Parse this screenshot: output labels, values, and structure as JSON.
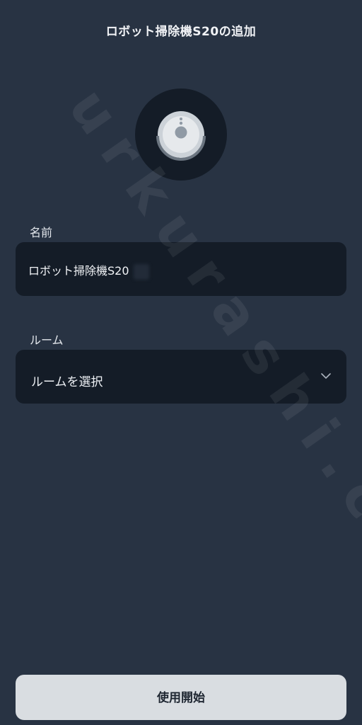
{
  "header": {
    "title": "ロボット掃除機S20の追加"
  },
  "device": {
    "icon": "robot-vacuum-icon"
  },
  "name_field": {
    "label": "名前",
    "value": "ロボット掃除機S20"
  },
  "room_field": {
    "label": "ルーム",
    "placeholder": "ルームを選択",
    "icon": "chevron-down-icon"
  },
  "footer": {
    "start_label": "使用開始"
  },
  "watermark": {
    "text": "urkurashi.com"
  },
  "colors": {
    "background": "#283343",
    "field_background": "#141c27",
    "button_background": "#d9dde1",
    "button_text": "#1e2631"
  }
}
